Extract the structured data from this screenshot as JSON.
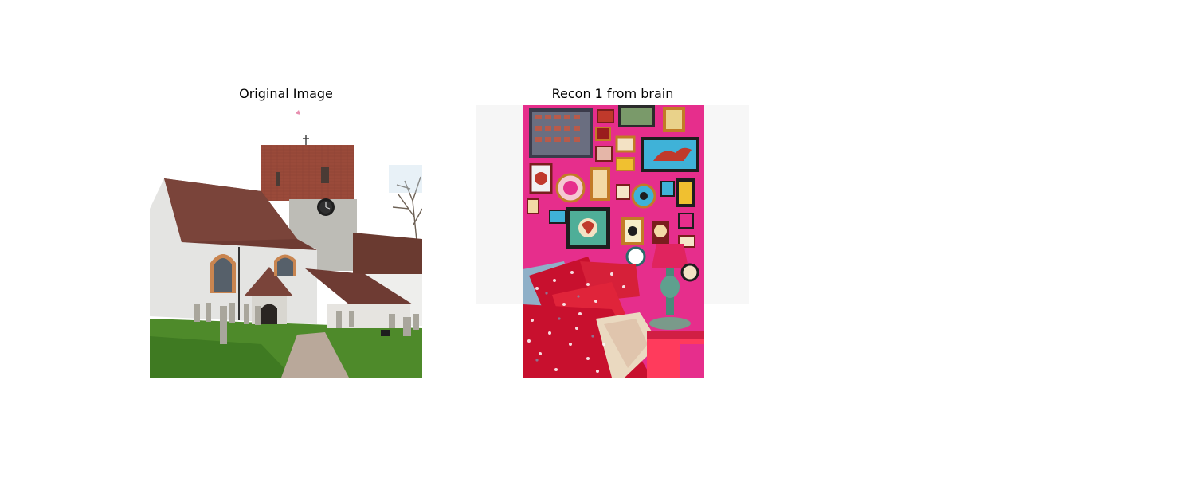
{
  "panels": [
    {
      "title": "Original Image",
      "image": "photo of a stone church with square brick tower, clock, tiled roofs, gravestones and grass path"
    },
    {
      "title": "Recon 1 from brain",
      "image": "reconstructed image of a bright pink bedroom wall covered with framed pictures, red floral bedding and a pink lamp"
    }
  ],
  "colors": {
    "background": "#ffffff",
    "text": "#000000",
    "church_wall": "#e4e4e2",
    "church_roof": "#6e3b33",
    "church_tower": "#9a4a3a",
    "grass": "#4e8a2a",
    "pink_wall": "#e62e8c",
    "bedding_red": "#c8102e"
  }
}
